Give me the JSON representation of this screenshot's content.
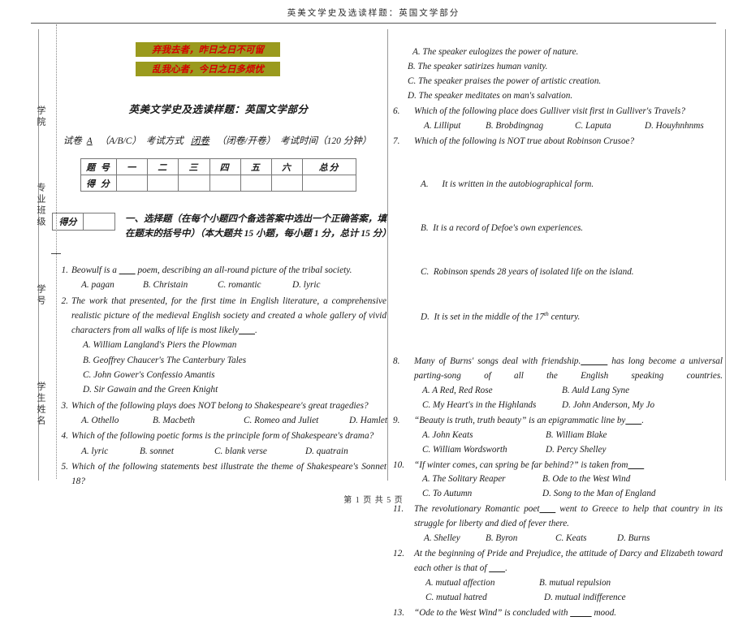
{
  "page": {
    "header_title": "英美文学史及选读样题：英国文学部分",
    "footer": "第 1 页 共 5 页"
  },
  "sidebar": {
    "labels": [
      "学院",
      "专业班级",
      "学号",
      "学生姓名"
    ]
  },
  "banner": {
    "colors": {
      "background": "#9a9a1e",
      "text": "#d40000"
    },
    "lines": [
      "弃我去者，昨日之日不可留",
      "乱我心者，今日之日多烦忧"
    ]
  },
  "exam": {
    "title": "英美文学史及选读样题：英国文学部分",
    "meta": {
      "paper_label": "试卷",
      "paper_value": "A",
      "paper_choices": "（A/B/C）",
      "mode_label": "考试方式",
      "mode_value": "闭卷",
      "mode_choices": "（闭卷/开卷）",
      "time_label": "考试时间（120 分钟）"
    },
    "score_table": {
      "row_head_label": "题 号",
      "row_score_label": "得 分",
      "columns": [
        "一",
        "二",
        "三",
        "四",
        "五",
        "六",
        "总分"
      ],
      "scores": [
        "",
        "",
        "",
        "",
        "",
        "",
        ""
      ]
    }
  },
  "section": {
    "defen_label": "得分",
    "defen_value": "",
    "title": "一、选择题（在每个小题四个备选答案中选出一个正确答案，填在题末的括号中）（本大题共 15 小题，每小题 1 分，总计 15 分）"
  },
  "questions_left": [
    {
      "num": "1.",
      "stem_a": "Beowulf is a ",
      "blank": "___",
      "stem_b": " poem, describing an all-round picture of the tribal society.",
      "options": [
        "A. pagan",
        "B. Christain",
        "C. romantic",
        "D. lyric"
      ]
    },
    {
      "num": "2.",
      "stem_a": "The work that presented, for the first time in English literature, a comprehensive realistic picture of the medieval English society and created a whole gallery of vivid characters from all walks of life is most likely",
      "blank": "___",
      "stem_b": ".",
      "options": [
        "A. William Langland's Piers the Plowman",
        "B. Geoffrey Chaucer's The Canterbury Tales",
        "C. John Gower's Confessio Amantis",
        "D. Sir Gawain and the Green Knight"
      ]
    },
    {
      "num": "3.",
      "stem_a": "Which of the following plays does NOT belong to Shakespeare's great tragedies?",
      "blank": "",
      "stem_b": "",
      "options": [
        "A. Othello",
        "B. Macbeth",
        "C. Romeo and Juliet",
        "D. Hamlet"
      ]
    },
    {
      "num": "4.",
      "stem_a": "Which of the following poetic forms is the principle form of Shakespeare's drama?",
      "blank": "",
      "stem_b": "",
      "options": [
        "A. lyric",
        "B. sonnet",
        "C. blank verse",
        "D. quatrain"
      ]
    },
    {
      "num": "5.",
      "stem_a": "Which of the following statements best illustrate the theme of Shakespeare's Sonnet 18?",
      "blank": "",
      "stem_b": "",
      "options": []
    }
  ],
  "continued_options_right": [
    "A. The speaker eulogizes the power of nature.",
    "B. The speaker satirizes human vanity.",
    "C. The speaker praises the power of artistic creation.",
    "D. The speaker meditates on man's salvation."
  ],
  "questions_right": [
    {
      "num": "6.",
      "stem_a": "Which of the following place does Gulliver visit first in Gulliver's Travels?",
      "blank": "",
      "stem_b": "",
      "options": [
        "A. Lilliput",
        "B. Brobdingnag",
        "C. Laputa",
        "D. Houyhnhnms"
      ]
    },
    {
      "num": "7.",
      "stem_a": "Which of the following is NOT true about Robinson Crusoe?",
      "blank": "",
      "stem_b": "",
      "options": [
        "A.      It is written in the autobiographical form.",
        "B.  It is a record of Defoe's own experiences.",
        "C.  Robinson spends 28 years of isolated life on the island.",
        "D.  It is set in the middle of the 17th century."
      ]
    },
    {
      "num": "8.",
      "stem_a": "Many of Burns' songs deal with friendship.",
      "blank": "_____",
      "stem_b": " has long become a universal parting-song of all the English speaking countries.",
      "options": [
        "A. A Red, Red Rose",
        "B. Auld Lang Syne",
        "C. My Heart's in the Highlands",
        "D. John Anderson, My Jo"
      ]
    },
    {
      "num": "9.",
      "stem_a": "“Beauty is truth, truth beauty” is an epigrammatic line by",
      "blank": "___",
      "stem_b": ".",
      "options": [
        "A. John Keats",
        "B. William Blake",
        "C. William Wordsworth",
        "D. Percy Shelley"
      ]
    },
    {
      "num": "10.",
      "stem_a": "“If winter comes, can spring be far behind?” is taken from",
      "blank": "___",
      "stem_b": "",
      "options": [
        "A. The Solitary Reaper",
        "B. Ode to the West Wind",
        "C. To Autumn",
        "D. Song to the Man of England"
      ]
    },
    {
      "num": "11.",
      "stem_a": "The revolutionary Romantic poet",
      "blank": "___",
      "stem_b": " went to Greece to help that country in its struggle for liberty and died of fever there.",
      "options": [
        "A. Shelley",
        "B. Byron",
        "C. Keats",
        "D. Burns"
      ]
    },
    {
      "num": "12.",
      "stem_a": "At the beginning of Pride and Prejudice, the attitude of Darcy and Elizabeth toward each other is that of ",
      "blank": "___",
      "stem_b": ".",
      "options": [
        "A. mutual affection",
        "B. mutual repulsion",
        "C. mutual hatred",
        "D. mutual indifference"
      ]
    },
    {
      "num": "13.",
      "stem_a": "“Ode to the West Wind” is concluded with ",
      "blank": "____",
      "stem_b": " mood.",
      "options": []
    }
  ]
}
